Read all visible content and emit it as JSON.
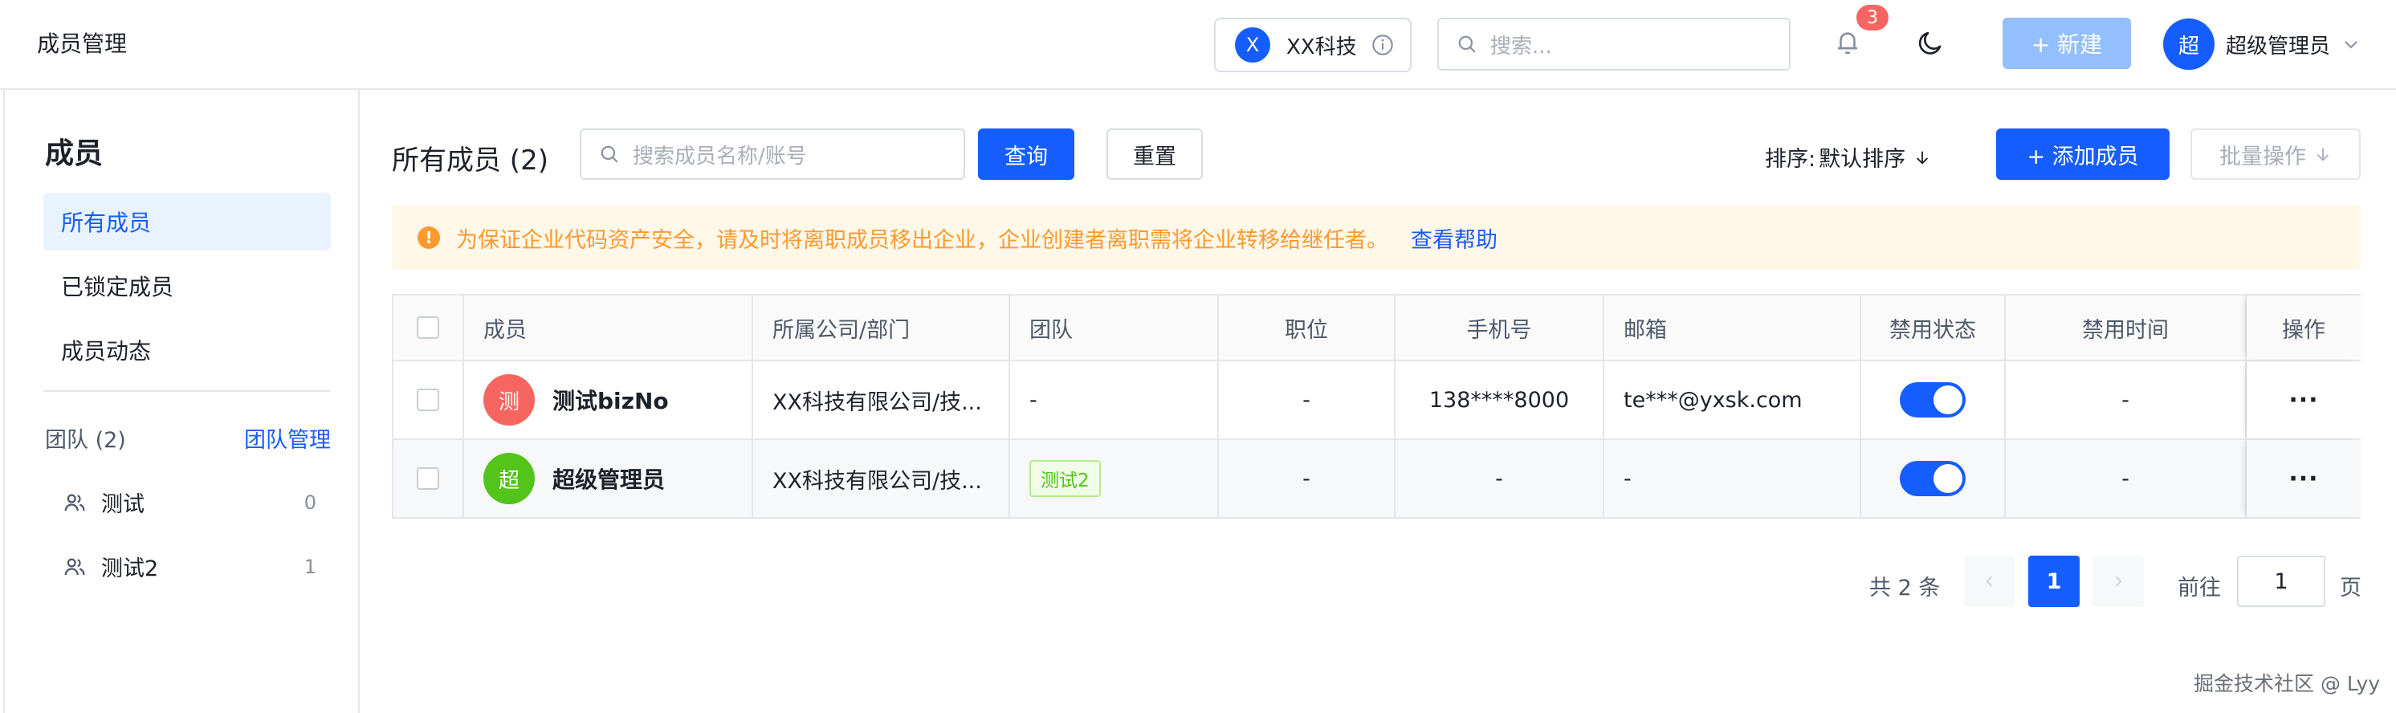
{
  "header": {
    "app_title": "成员管理",
    "org": {
      "avatar_letter": "X",
      "name": "XX科技",
      "info_icon": "info-circle-icon"
    },
    "search": {
      "placeholder": "搜索...",
      "icon": "search-icon"
    },
    "notifications": {
      "icon": "bell-icon",
      "badge": "3"
    },
    "theme_icon": "moon-icon",
    "new_button": "+ 新建",
    "user": {
      "avatar_char": "超",
      "name": "超级管理员",
      "caret_icon": "chevron-down-icon"
    }
  },
  "sidebar": {
    "title": "成员",
    "items": [
      {
        "label": "所有成员",
        "active": true
      },
      {
        "label": "已锁定成员",
        "active": false
      },
      {
        "label": "成员动态",
        "active": false
      }
    ],
    "team_section": {
      "label": "团队 (2)",
      "manage_link": "团队管理"
    },
    "teams": [
      {
        "name": "测试",
        "count": "0",
        "icon": "users-icon"
      },
      {
        "name": "测试2",
        "count": "1",
        "icon": "users-icon"
      }
    ]
  },
  "main": {
    "title": "所有成员 (2)",
    "search": {
      "placeholder": "搜索成员名称/账号",
      "icon": "search-icon"
    },
    "query_button": "查询",
    "reset_button": "重置",
    "sort": {
      "label": "排序:",
      "value": "默认排序",
      "icon": "arrow-down-icon"
    },
    "add_button": "+ 添加成员",
    "batch_button": "批量操作",
    "batch_icon": "arrow-down-icon",
    "alert": {
      "icon": "warning-icon",
      "message": "为保证企业代码资产安全，请及时将离职成员移出企业，企业创建者离职需将企业转移给继任者。",
      "link": "查看帮助"
    }
  },
  "table": {
    "columns": [
      "成员",
      "所属公司/部门",
      "团队",
      "职位",
      "手机号",
      "邮箱",
      "禁用状态",
      "禁用时间",
      "操作"
    ],
    "rows": [
      {
        "avatar_char": "测",
        "avatar_color": "#f76560",
        "name": "测试bizNo",
        "company": "XX科技有限公司/技...",
        "team": "-",
        "team_is_tag": false,
        "position": "-",
        "phone": "138****8000",
        "email": "te***@yxsk.com",
        "disabled": true,
        "disabled_time": "-",
        "action_icon": "more-icon"
      },
      {
        "avatar_char": "超",
        "avatar_color": "#52c41a",
        "name": "超级管理员",
        "company": "XX科技有限公司/技...",
        "team": "测试2",
        "team_is_tag": true,
        "position": "-",
        "phone": "-",
        "email": "-",
        "disabled": true,
        "disabled_time": "-",
        "action_icon": "more-icon"
      }
    ]
  },
  "pagination": {
    "total": "共 2 条",
    "current_page": "1",
    "goto_label": "前往",
    "goto_value": "1",
    "page_unit": "页"
  },
  "watermark": "掘金技术社区 @ Lyy",
  "colors": {
    "primary": "#165dff",
    "warning": "#ff9a2e",
    "alert_bg": "#fff7e8",
    "tag_green": "#52c41a"
  }
}
